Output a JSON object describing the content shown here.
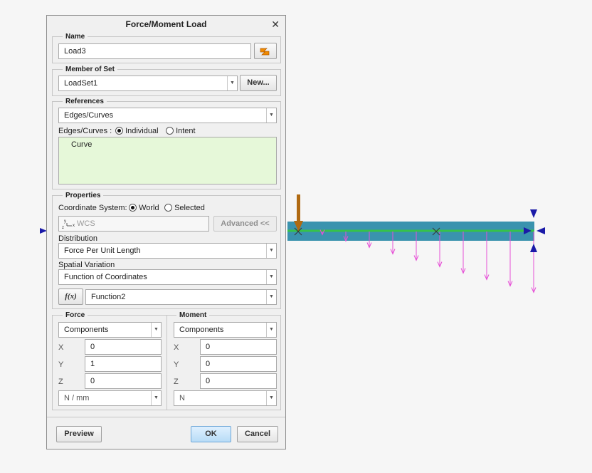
{
  "dialog": {
    "title": "Force/Moment Load",
    "close_glyph": "✕"
  },
  "name_group": {
    "legend": "Name",
    "value": "Load3"
  },
  "member_group": {
    "legend": "Member of Set",
    "selected": "LoadSet1",
    "new_button": "New..."
  },
  "references": {
    "legend": "References",
    "type": "Edges/Curves",
    "mode_label": "Edges/Curves :",
    "options": [
      "Individual",
      "Intent"
    ],
    "selected_option": "Individual",
    "items": [
      "Curve"
    ],
    "list_bg": "#e6f8d9"
  },
  "properties": {
    "legend": "Properties",
    "coord_label": "Coordinate System:",
    "coord_options": [
      "World",
      "Selected"
    ],
    "coord_selected": "World",
    "csys_value": "WCS",
    "advanced_button": "Advanced <<",
    "distribution_label": "Distribution",
    "distribution": "Force Per Unit Length",
    "spatial_label": "Spatial Variation",
    "spatial": "Function of Coordinates",
    "function_button": "f(x)",
    "function": "Function2"
  },
  "force": {
    "legend": "Force",
    "mode": "Components",
    "axes": [
      {
        "axis": "X",
        "value": "0"
      },
      {
        "axis": "Y",
        "value": "1"
      },
      {
        "axis": "Z",
        "value": "0"
      }
    ],
    "units": "N / mm"
  },
  "moment": {
    "legend": "Moment",
    "mode": "Components",
    "axes": [
      {
        "axis": "X",
        "value": "0"
      },
      {
        "axis": "Y",
        "value": "0"
      },
      {
        "axis": "Z",
        "value": "0"
      }
    ],
    "units": "N"
  },
  "footer": {
    "preview": "Preview",
    "ok": "OK",
    "cancel": "Cancel"
  },
  "viewport": {
    "beam_color": "#3a93ae",
    "curve_color": "#36c24a",
    "load_arrow_color": "#e650d6",
    "point_load_color": "#b06a12",
    "constraint_color": "#1a1aa8",
    "distributed_load_fractions": [
      0.06,
      0.18,
      0.3,
      0.42,
      0.54,
      0.66,
      0.78,
      0.9,
      1.02,
      1.14
    ]
  }
}
